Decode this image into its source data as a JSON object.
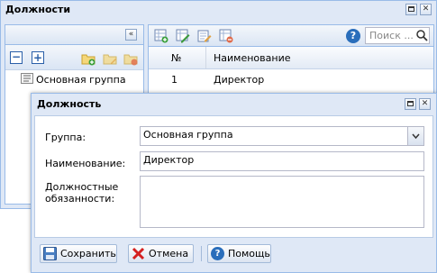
{
  "main_window": {
    "title": "Должности",
    "search_placeholder": "Поиск ..."
  },
  "tree": {
    "items": [
      {
        "label": "Основная группа"
      }
    ]
  },
  "grid": {
    "columns": [
      "№",
      "Наименование"
    ],
    "rows": [
      {
        "num": "1",
        "name": "Директор"
      }
    ]
  },
  "dialog": {
    "title": "Должность",
    "group_label": "Группа:",
    "group_value": "Основная группа",
    "name_label": "Наименование:",
    "name_value": "Директор",
    "duties_label_line1": "Должностные",
    "duties_label_line2": "обязанности:",
    "duties_value": "",
    "save_label": "Сохранить",
    "cancel_label": "Отмена",
    "help_label": "Помощь"
  },
  "colors": {
    "frame": "#dfe8f6",
    "border": "#99bbe8",
    "help_blue": "#2a6ebb",
    "cancel_red": "#d42020"
  }
}
